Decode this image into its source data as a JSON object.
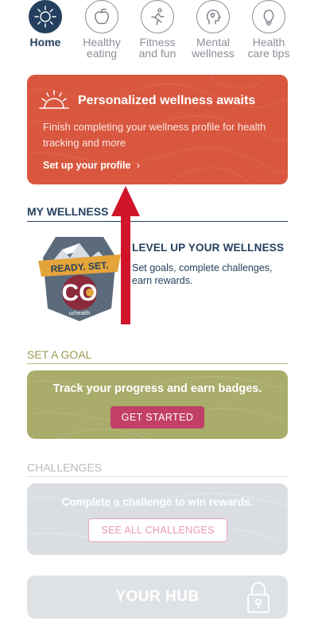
{
  "nav": {
    "items": [
      {
        "label1": "Home",
        "label2": "",
        "icon": "sun-icon"
      },
      {
        "label1": "Healthy",
        "label2": "eating",
        "icon": "apple-icon"
      },
      {
        "label1": "Fitness",
        "label2": "and fun",
        "icon": "runner-icon"
      },
      {
        "label1": "Mental",
        "label2": "wellness",
        "icon": "head-heart-icon"
      },
      {
        "label1": "Health",
        "label2": "care tips",
        "icon": "lightbulb-icon"
      }
    ],
    "active_index": 0
  },
  "promo": {
    "title": "Personalized wellness awaits",
    "text": "Finish completing your wellness profile for health tracking and more",
    "link": "Set up your profile",
    "link_chevron": "›",
    "color": "#d9573f"
  },
  "my_wellness": {
    "heading": "MY WELLNESS",
    "title": "LEVEL UP YOUR WELLNESS",
    "description": "Set goals, complete challenges, earn rewards.",
    "badge": {
      "banner": "READY. SET.",
      "letters": "CO",
      "brand": "uchealth"
    }
  },
  "set_goal": {
    "heading": "SET A GOAL",
    "text": "Track your progress and earn badges.",
    "button": "GET STARTED",
    "color": "#a9ac6a",
    "button_color": "#c23f68"
  },
  "challenges": {
    "heading": "CHALLENGES",
    "text": "Complete a challenge to win rewards.",
    "button": "SEE ALL CHALLENGES"
  },
  "hub": {
    "label": "YOUR HUB",
    "icon": "lock-icon"
  },
  "annotation": {
    "icon": "red-arrow-up-icon",
    "color": "#d0152a"
  }
}
